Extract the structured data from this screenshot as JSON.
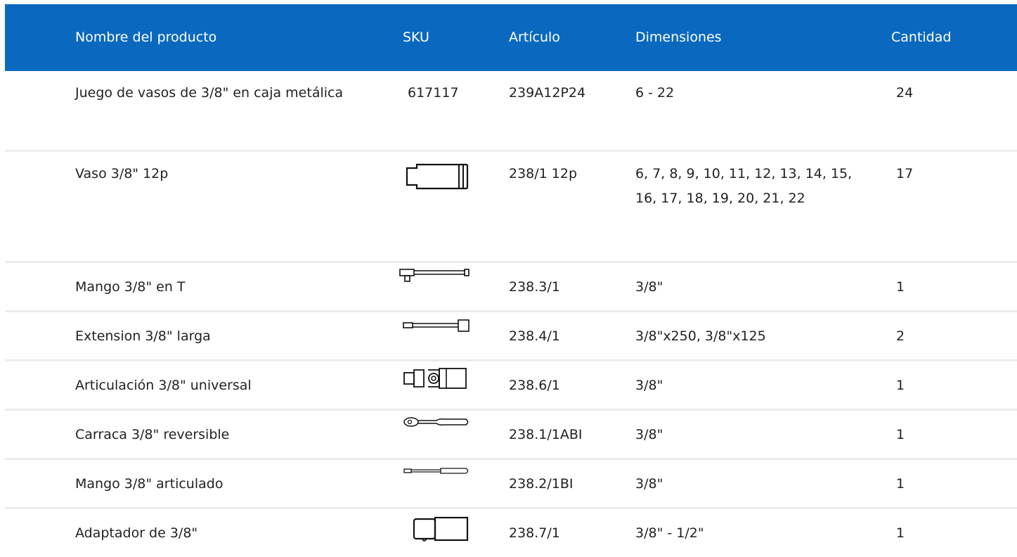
{
  "headers": {
    "name": "Nombre del producto",
    "sku": "SKU",
    "article": "Artículo",
    "dimensions": "Dimensiones",
    "quantity": "Cantidad"
  },
  "rows": [
    {
      "name": "Juego de vasos de 3/8\" en caja metálica",
      "sku": "617117",
      "article": "239A12P24",
      "dimensions": "6 - 22",
      "quantity": "24",
      "image": ""
    },
    {
      "name": "Vaso 3/8\" 12p",
      "sku": "",
      "article": "238/1 12p",
      "dimensions": "6, 7, 8, 9, 10, 11, 12, 13, 14, 15, 16, 17, 18, 19, 20, 21, 22",
      "quantity": "17",
      "image": "socket-icon"
    },
    {
      "name": "Mango 3/8\" en T",
      "sku": "",
      "article": "238.3/1",
      "dimensions": "3/8\"",
      "quantity": "1",
      "image": "t-handle-icon"
    },
    {
      "name": "Extension 3/8\" larga",
      "sku": "",
      "article": "238.4/1",
      "dimensions": "3/8\"x250, 3/8\"x125",
      "quantity": "2",
      "image": "extension-bar-icon"
    },
    {
      "name": "Articulación 3/8\" universal",
      "sku": "",
      "article": "238.6/1",
      "dimensions": "3/8\"",
      "quantity": "1",
      "image": "universal-joint-icon"
    },
    {
      "name": "Carraca 3/8\" reversible",
      "sku": "",
      "article": "238.1/1ABI",
      "dimensions": "3/8\"",
      "quantity": "1",
      "image": "ratchet-icon"
    },
    {
      "name": "Mango 3/8\" articulado",
      "sku": "",
      "article": "238.2/1BI",
      "dimensions": "3/8\"",
      "quantity": "1",
      "image": "hinged-handle-icon"
    },
    {
      "name": "Adaptador de 3/8\"",
      "sku": "",
      "article": "238.7/1",
      "dimensions": "3/8\" - 1/2\"",
      "quantity": "1",
      "image": "adapter-icon"
    }
  ]
}
